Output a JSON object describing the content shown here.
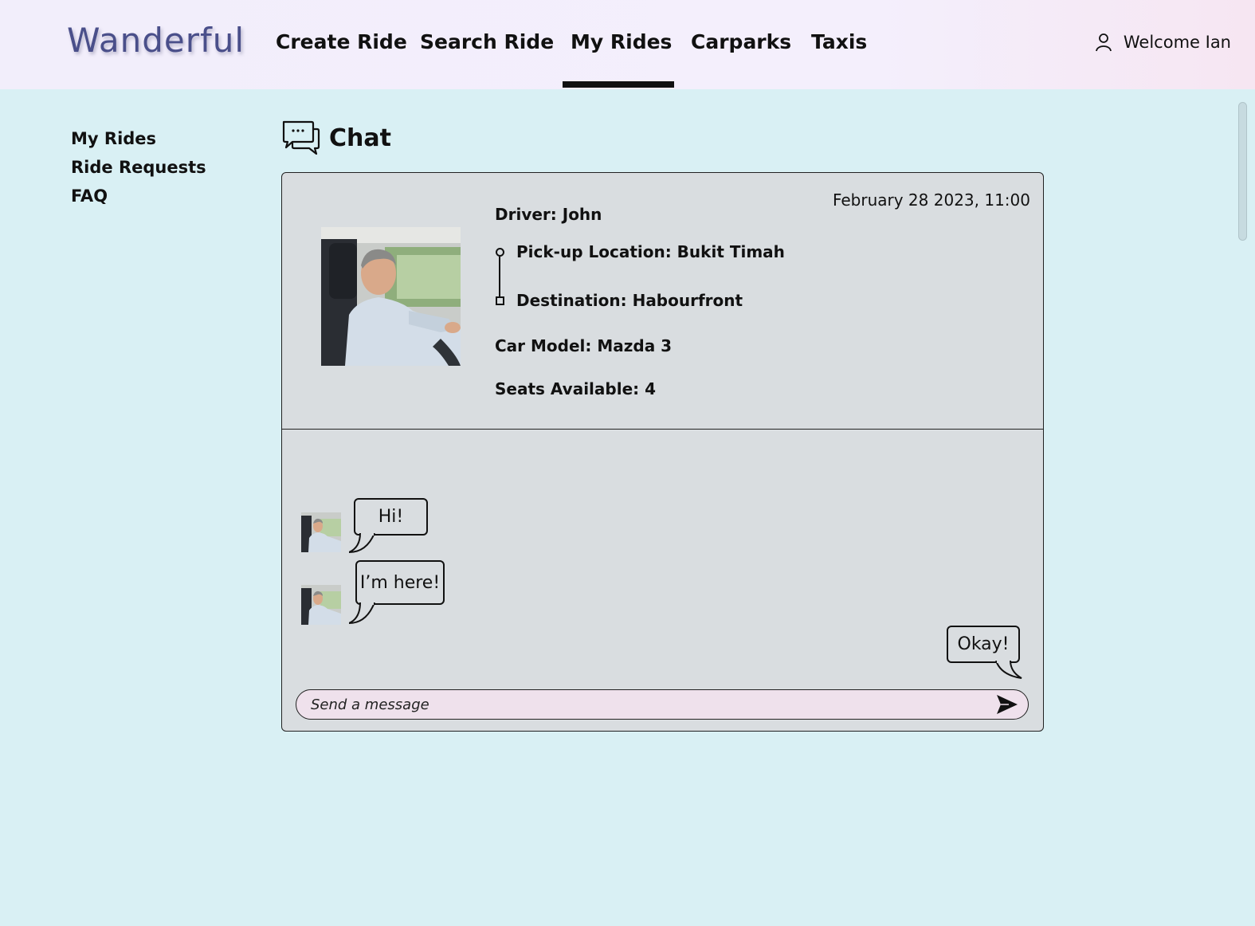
{
  "app": {
    "logo": "Wanderful",
    "welcome": "Welcome Ian"
  },
  "nav": {
    "items": [
      "Create Ride",
      "Search Ride",
      "My Rides",
      "Carparks",
      "Taxis"
    ],
    "active": "My Rides"
  },
  "sidebar": {
    "items": [
      "My Rides",
      "Ride Requests",
      "FAQ"
    ]
  },
  "chat": {
    "title": "Chat",
    "ride": {
      "date": "February 28 2023, 11:00",
      "driver": "Driver: John",
      "pickup": "Pick-up Location: Bukit Timah",
      "destination": "Destination: Habourfront",
      "car_model": "Car Model: Mazda 3",
      "seats": "Seats Available: 4"
    },
    "messages": [
      {
        "from": "driver",
        "text": "Hi!"
      },
      {
        "from": "driver",
        "text": "I’m here!"
      },
      {
        "from": "me",
        "text": "Okay!"
      }
    ],
    "input": {
      "placeholder": "Send a message",
      "value": ""
    }
  },
  "colors": {
    "background": "#d9f0f4",
    "panel": "#d9dde0",
    "input": "#efe1ec",
    "logo": "#4a4f8a"
  },
  "icons": {
    "user": "user-icon",
    "chat": "chat-bubbles-icon",
    "send": "send-icon"
  }
}
